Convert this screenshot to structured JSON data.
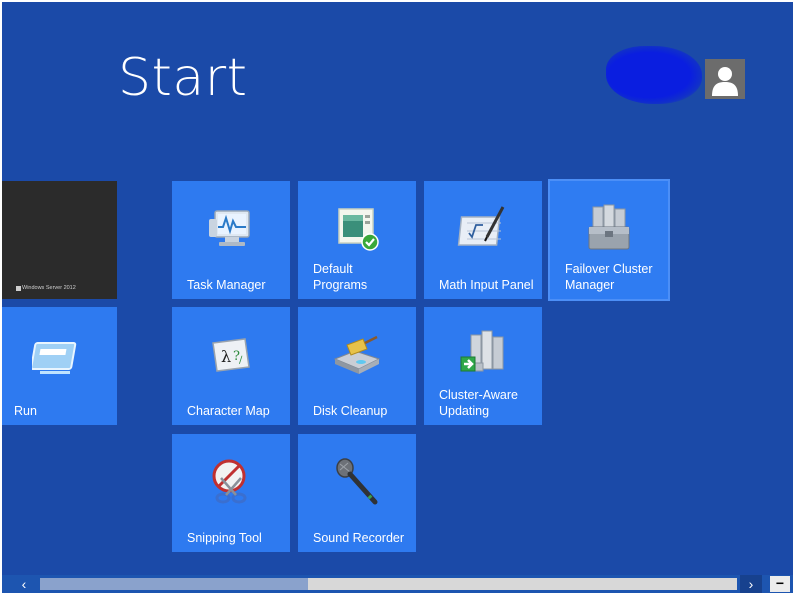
{
  "header": {
    "title": "Start"
  },
  "user": {
    "avatar_icon": "user-avatar-icon"
  },
  "desktop_tile": {
    "caption": "Windows Server 2012",
    "icon": "windows-logo-icon"
  },
  "tiles": {
    "run": {
      "label": "Run",
      "icon": "run-icon"
    },
    "task_manager": {
      "label": "Task Manager",
      "icon": "task-manager-icon"
    },
    "default_programs": {
      "label": "Default\nPrograms",
      "icon": "default-programs-icon"
    },
    "math_input_panel": {
      "label": "Math Input Panel",
      "icon": "math-input-icon"
    },
    "failover_cluster_manager": {
      "label": "Failover Cluster\nManager",
      "icon": "failover-cluster-icon"
    },
    "character_map": {
      "label": "Character Map",
      "icon": "character-map-icon"
    },
    "disk_cleanup": {
      "label": "Disk Cleanup",
      "icon": "disk-cleanup-icon"
    },
    "cluster_aware_updating": {
      "label": "Cluster-Aware\nUpdating",
      "icon": "cluster-updating-icon"
    },
    "snipping_tool": {
      "label": "Snipping Tool",
      "icon": "snipping-tool-icon"
    },
    "sound_recorder": {
      "label": "Sound Recorder",
      "icon": "sound-recorder-icon"
    }
  },
  "scrollbar": {
    "left_glyph": "‹",
    "right_glyph": "›",
    "zoom_glyph": "−"
  },
  "colors": {
    "background": "#1b4aa8",
    "tile": "#2e7af0",
    "desktop_tile": "#2b2b2b"
  }
}
